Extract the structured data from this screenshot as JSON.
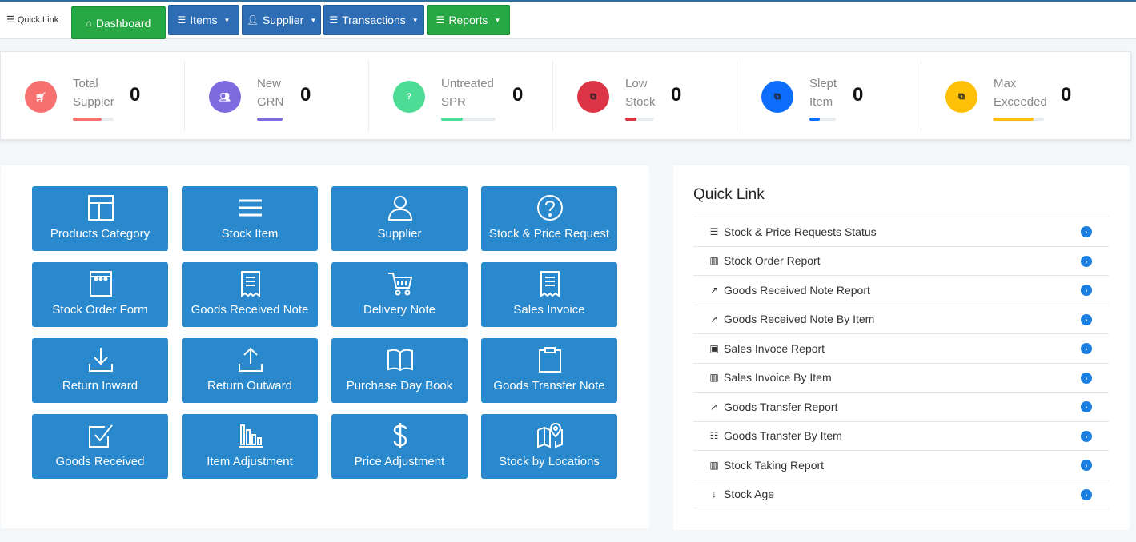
{
  "nav": {
    "quick_link": "Quick Link",
    "dashboard": "Dashboard",
    "items": "Items",
    "supplier": "Supplier",
    "transactions": "Transactions",
    "reports": "Reports"
  },
  "stats": [
    {
      "line1": "Total",
      "line2": "Suppler",
      "value": "0",
      "color": "#f87171",
      "progress": 0.7
    },
    {
      "line1": "New",
      "line2": "GRN",
      "value": "0",
      "color": "#7f6be0",
      "progress": 1.0
    },
    {
      "line1": "Untreated",
      "line2": "SPR",
      "value": "0",
      "color": "#4ddc95",
      "progress": 0.4
    },
    {
      "line1": "Low",
      "line2": "Stock",
      "value": "0",
      "color": "#dc3545",
      "progress": 0.4
    },
    {
      "line1": "Slept",
      "line2": "Item",
      "value": "0",
      "color": "#0d6efd",
      "progress": 0.4
    },
    {
      "line1": "Max",
      "line2": "Exceeded",
      "value": "0",
      "color": "#ffc107",
      "progress": 0.8
    }
  ],
  "tiles": [
    {
      "label": "Products Category",
      "icon": "layout-icon"
    },
    {
      "label": "Stock Item",
      "icon": "list-icon"
    },
    {
      "label": "Supplier",
      "icon": "user-icon"
    },
    {
      "label": "Stock & Price Request",
      "icon": "question-icon"
    },
    {
      "label": "Stock Order Form",
      "icon": "order-form-icon"
    },
    {
      "label": "Goods Received Note",
      "icon": "receipt-icon"
    },
    {
      "label": "Delivery Note",
      "icon": "cart-icon"
    },
    {
      "label": "Sales Invoice",
      "icon": "invoice-icon"
    },
    {
      "label": "Return Inward",
      "icon": "download-icon"
    },
    {
      "label": "Return Outward",
      "icon": "upload-icon"
    },
    {
      "label": "Purchase Day Book",
      "icon": "book-icon"
    },
    {
      "label": "Goods Transfer Note",
      "icon": "clipboard-icon"
    },
    {
      "label": "Goods Received",
      "icon": "checkbox-icon"
    },
    {
      "label": "Item Adjustment",
      "icon": "bar-chart-icon"
    },
    {
      "label": "Price Adjustment",
      "icon": "dollar-icon"
    },
    {
      "label": "Stock by Locations",
      "icon": "map-icon"
    }
  ],
  "quick_links": {
    "title": "Quick Link",
    "items": [
      {
        "label": "Stock & Price Requests Status",
        "icon": "list-icon"
      },
      {
        "label": "Stock Order Report",
        "icon": "bar-chart-icon"
      },
      {
        "label": "Goods Received Note Report",
        "icon": "line-chart-icon"
      },
      {
        "label": "Goods Received Note By Item",
        "icon": "line-chart-icon"
      },
      {
        "label": "Sales Invoce Report",
        "icon": "money-icon"
      },
      {
        "label": "Sales Invoice By Item",
        "icon": "bar-chart-icon"
      },
      {
        "label": "Goods Transfer Report",
        "icon": "line-chart-icon"
      },
      {
        "label": "Goods Transfer By Item",
        "icon": "list-icon"
      },
      {
        "label": "Stock Taking Report",
        "icon": "bar-chart-icon"
      },
      {
        "label": "Stock Age",
        "icon": "sort-icon"
      }
    ]
  }
}
